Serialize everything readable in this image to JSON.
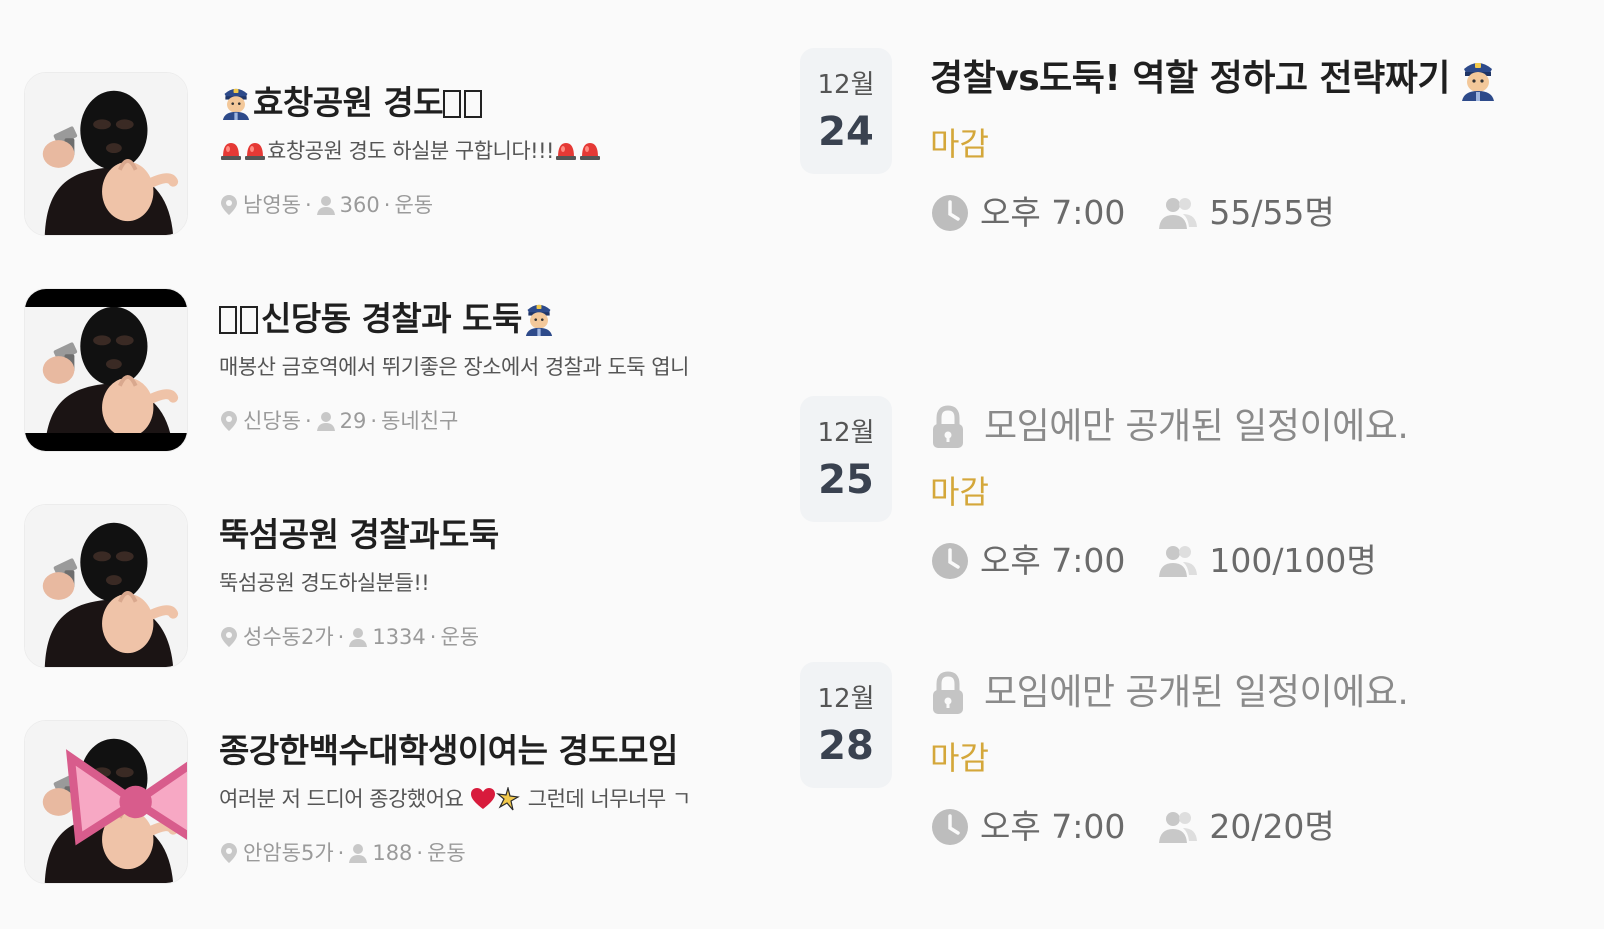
{
  "groups": [
    {
      "title": "효창공원 경도",
      "description": "효창공원 경도 하실분 구합니다!!!",
      "location": "남영동",
      "members": "360",
      "category": "운동"
    },
    {
      "title": "신당동 경찰과 도둑",
      "description": "매봉산 금호역에서 뛰기좋은 장소에서 경찰과 도둑 엽니",
      "location": "신당동",
      "members": "29",
      "category": "동네친구"
    },
    {
      "title": "뚝섬공원 경찰과도둑",
      "description": "뚝섬공원 경도하실분들!!",
      "location": "성수동2가",
      "members": "1334",
      "category": "운동"
    },
    {
      "title": "종강한백수대학생이여는 경도모임",
      "description_start": "여러분 저 드디어 종강했어요",
      "description_end": "그런데 너무너무 ㄱ",
      "location": "안암동5가",
      "members": "188",
      "category": "운동"
    }
  ],
  "meta_separator": "·",
  "schedules": [
    {
      "month": "12월",
      "day": "24",
      "title": "경찰vs도둑! 역할 정하고 전략짜기",
      "status": "마감",
      "time": "오후 7:00",
      "capacity": "55/55명",
      "locked": false
    },
    {
      "month": "12월",
      "day": "25",
      "title": "모임에만 공개된 일정이에요.",
      "status": "마감",
      "time": "오후 7:00",
      "capacity": "100/100명",
      "locked": true
    },
    {
      "month": "12월",
      "day": "28",
      "title": "모임에만 공개된 일정이에요.",
      "status": "마감",
      "time": "오후 7:00",
      "capacity": "20/20명",
      "locked": true
    }
  ],
  "colors": {
    "status_closed": "#d4a73a",
    "date_box_bg": "#f1f3f5",
    "meta_gray": "#9a9a9a"
  },
  "icons": {
    "location": "map-pin-icon",
    "members": "person-icon",
    "time": "clock-icon",
    "capacity": "people-icon",
    "locked": "lock-icon",
    "emoji": "police-officer-emoji"
  }
}
